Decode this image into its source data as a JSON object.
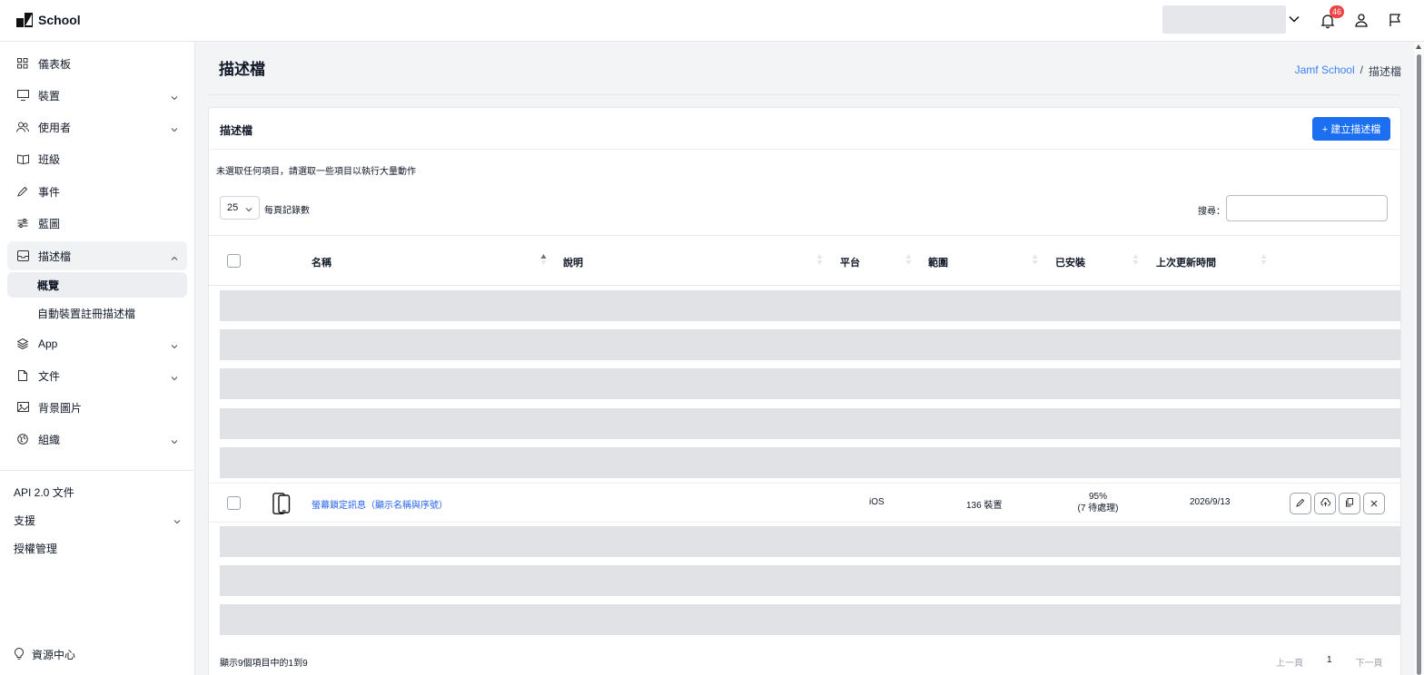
{
  "topbar": {
    "brand": "School",
    "notification_count": "46"
  },
  "sidebar": {
    "items": [
      {
        "label": "儀表板",
        "icon": "dashboard-icon"
      },
      {
        "label": "裝置",
        "icon": "monitor-icon"
      },
      {
        "label": "使用者",
        "icon": "users-icon"
      },
      {
        "label": "班級",
        "icon": "book-icon"
      },
      {
        "label": "事件",
        "icon": "pencil-icon"
      },
      {
        "label": "藍圖",
        "icon": "sliders-icon"
      },
      {
        "label": "描述檔",
        "icon": "inbox-icon"
      },
      {
        "label": "App",
        "icon": "layers-icon"
      },
      {
        "label": "文件",
        "icon": "file-icon"
      },
      {
        "label": "背景圖片",
        "icon": "image-icon"
      },
      {
        "label": "組織",
        "icon": "globe-icon"
      }
    ],
    "sub_items": [
      "概覽",
      "自動裝置註冊描述檔"
    ],
    "links": [
      "API 2.0 文件",
      "支援",
      "授權管理"
    ],
    "resource_center": "資源中心"
  },
  "page": {
    "title": "描述檔",
    "breadcrumb": {
      "root": "Jamf School",
      "separator": "/",
      "current": "描述檔"
    }
  },
  "card": {
    "title": "描述檔",
    "create_button": "+ 建立描述檔",
    "bulk_message": "未選取任何項目，請選取一些項目以執行大量動作",
    "per_page_value": "25",
    "per_page_label": "每頁記錄數",
    "search_label": "搜尋："
  },
  "table": {
    "columns": [
      "名稱",
      "說明",
      "平台",
      "範圍",
      "已安裝",
      "上次更新時間"
    ],
    "rows": [
      {
        "name": "螢幕鎖定訊息（顯示名稱與序號）",
        "description": "",
        "platform": "iOS",
        "scope": "136 裝置",
        "installed_pct": "95%",
        "installed_pending": "(7 待處理)",
        "updated": "2026/9/13"
      }
    ]
  },
  "footer": {
    "info": "顯示9個項目中的1到9",
    "prev": "上一頁",
    "page": "1",
    "next": "下一頁"
  },
  "colors": {
    "accent": "#1d6ff2",
    "link": "#2563eb",
    "badge": "#ef4444",
    "skeleton": "#e0e2e6"
  }
}
